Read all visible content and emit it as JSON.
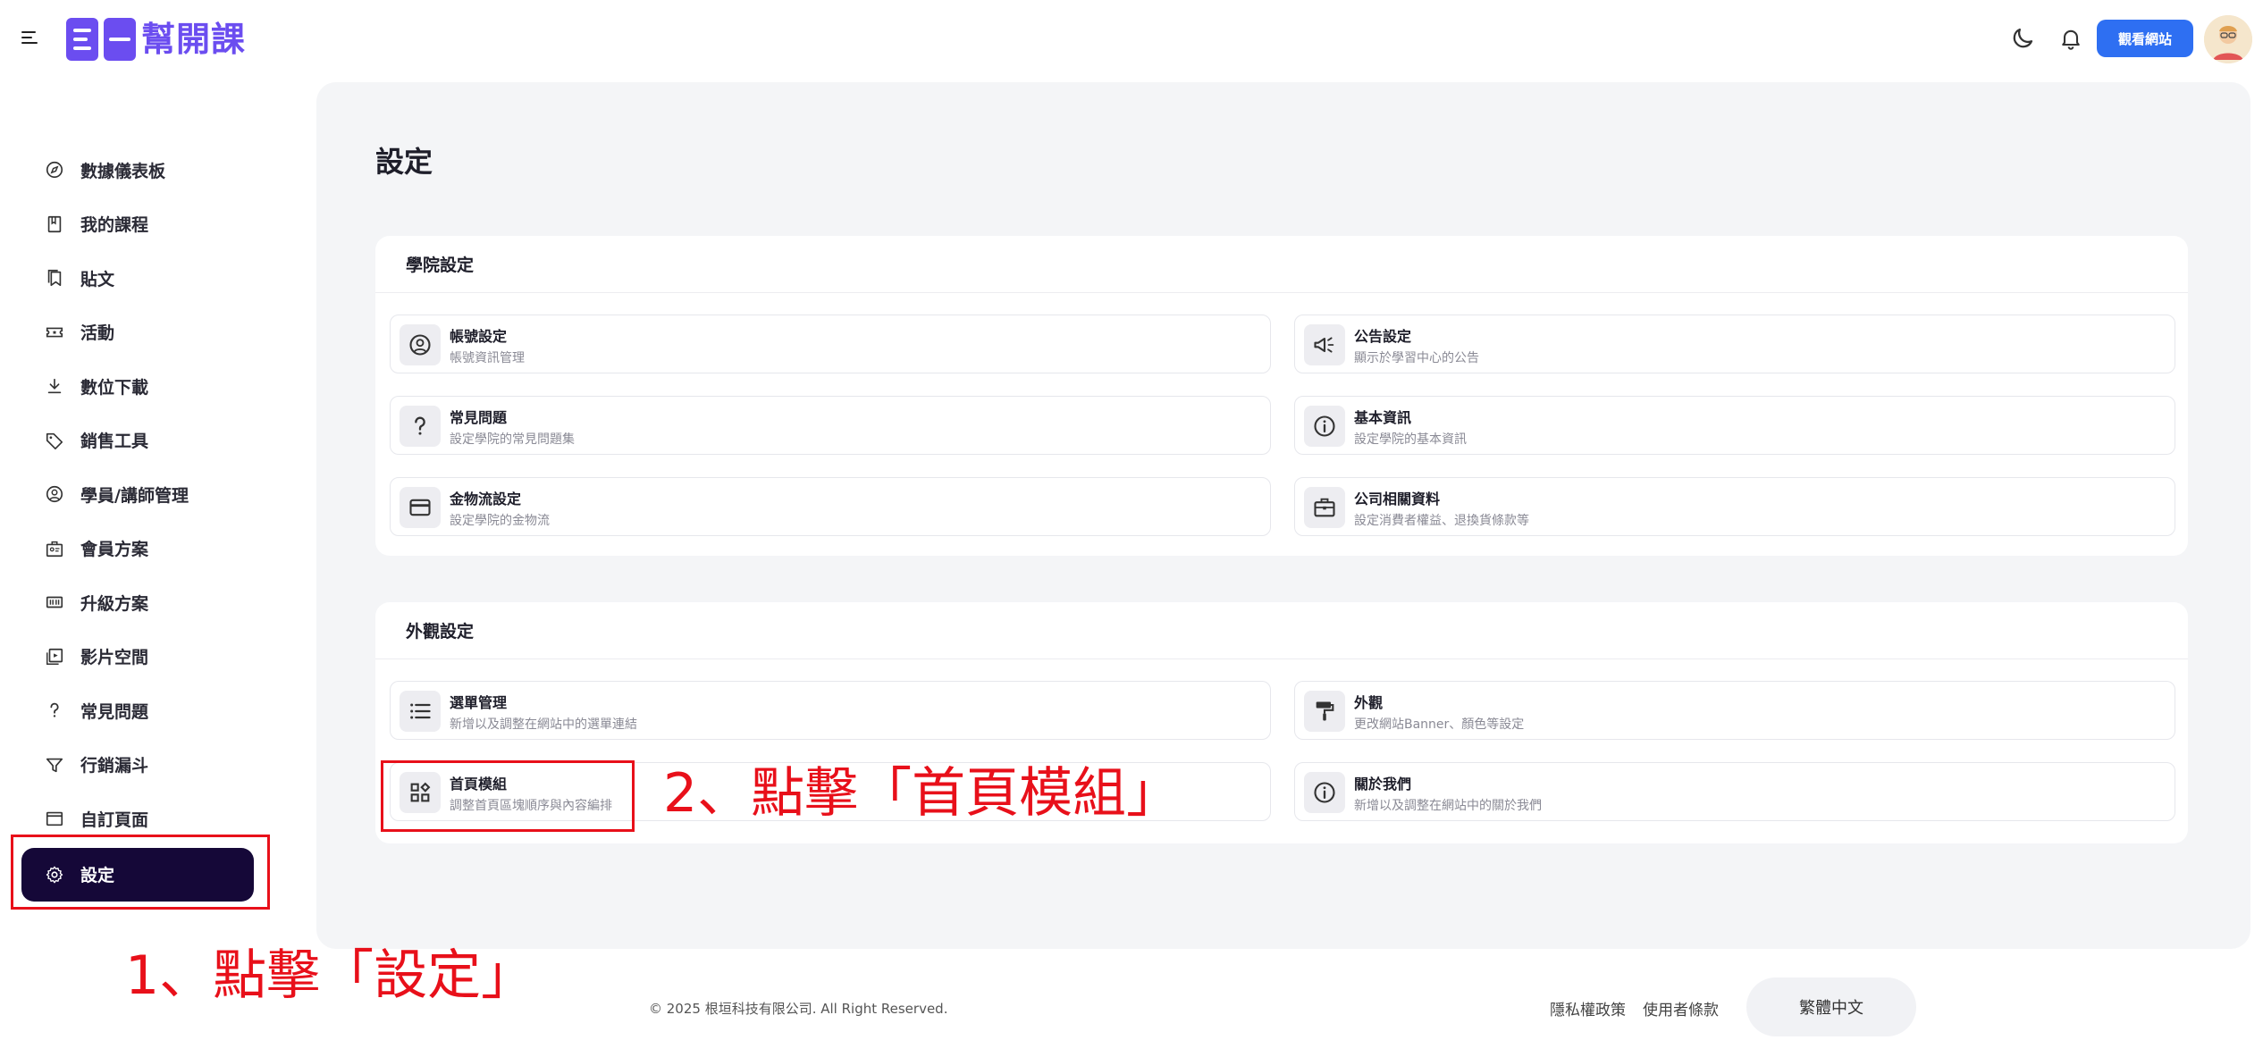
{
  "header": {
    "logo_text": "幫開課",
    "view_site_label": "觀看網站"
  },
  "sidebar": {
    "items": [
      {
        "label": "數據儀表板",
        "icon": "compass-icon"
      },
      {
        "label": "我的課程",
        "icon": "book-icon"
      },
      {
        "label": "貼文",
        "icon": "bookmark-icon"
      },
      {
        "label": "活動",
        "icon": "ticket-icon"
      },
      {
        "label": "數位下載",
        "icon": "download-icon"
      },
      {
        "label": "銷售工具",
        "icon": "tag-icon"
      },
      {
        "label": "學員/講師管理",
        "icon": "user-circle-icon"
      },
      {
        "label": "會員方案",
        "icon": "membership-icon"
      },
      {
        "label": "升級方案",
        "icon": "upgrade-icon"
      },
      {
        "label": "影片空間",
        "icon": "video-icon"
      },
      {
        "label": "常見問題",
        "icon": "question-icon"
      },
      {
        "label": "行銷漏斗",
        "icon": "funnel-icon"
      },
      {
        "label": "自訂頁面",
        "icon": "window-icon"
      },
      {
        "label": "設定",
        "icon": "gear-icon",
        "active": true
      }
    ]
  },
  "main": {
    "title": "設定",
    "sections": [
      {
        "title": "學院設定",
        "items": [
          {
            "title": "帳號設定",
            "desc": "帳號資訊管理",
            "icon": "user-circle-icon"
          },
          {
            "title": "公告設定",
            "desc": "顯示於學習中心的公告",
            "icon": "megaphone-icon"
          },
          {
            "title": "常見問題",
            "desc": "設定學院的常見問題集",
            "icon": "question-icon"
          },
          {
            "title": "基本資訊",
            "desc": "設定學院的基本資訊",
            "icon": "info-icon"
          },
          {
            "title": "金物流設定",
            "desc": "設定學院的金物流",
            "icon": "credit-card-icon"
          },
          {
            "title": "公司相關資料",
            "desc": "設定消費者權益、退換貨條款等",
            "icon": "briefcase-icon"
          }
        ]
      },
      {
        "title": "外觀設定",
        "items": [
          {
            "title": "選單管理",
            "desc": "新增以及調整在網站中的選單連結",
            "icon": "list-icon"
          },
          {
            "title": "外觀",
            "desc": "更改網站Banner、顏色等設定",
            "icon": "paint-roller-icon"
          },
          {
            "title": "首頁模組",
            "desc": "調整首頁區塊順序與內容編排",
            "icon": "modules-icon"
          },
          {
            "title": "關於我們",
            "desc": "新增以及調整在網站中的關於我們",
            "icon": "info-icon"
          }
        ]
      }
    ]
  },
  "annotations": {
    "step1": "1、點擊「設定」",
    "step2": "2、點擊「首頁模組」",
    "color": "#e8101a"
  },
  "footer": {
    "copyright": "© 2025 根垣科技有限公司. All Right Reserved.",
    "privacy": "隱私權政策",
    "terms": "使用者條款",
    "language": "繁體中文"
  },
  "colors": {
    "accent": "#2e6ff2",
    "brand": "#6b4df0",
    "active_nav": "#150838"
  }
}
